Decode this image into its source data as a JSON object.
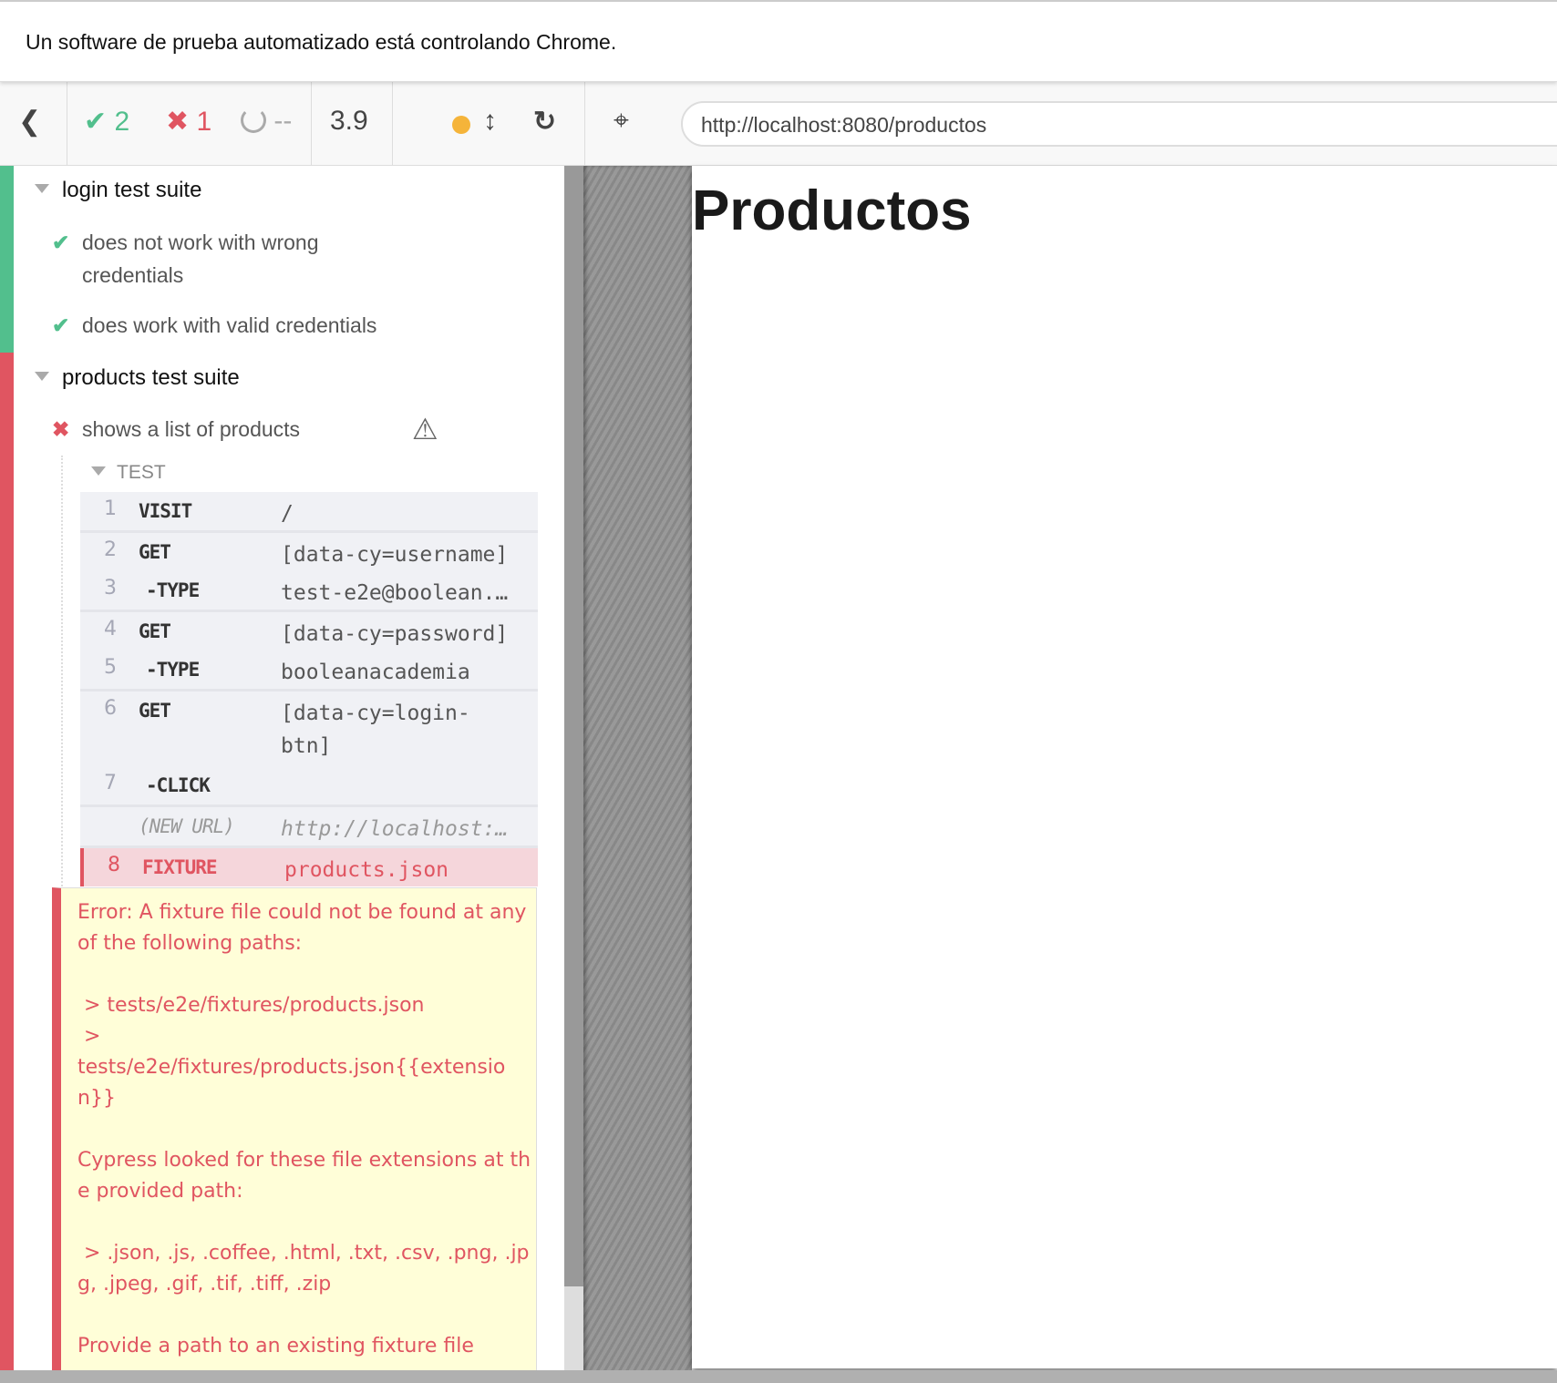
{
  "banner": "Un software de prueba automatizado está controlando Chrome.",
  "toolbar": {
    "passed": "2",
    "failed": "1",
    "pending": "--",
    "duration": "3.9",
    "url": "http://localhost:8080/productos"
  },
  "suites": [
    {
      "title": "login test suite",
      "tests": [
        {
          "title": "does not work with wrong credentials",
          "state": "passed"
        },
        {
          "title": "does work with valid credentials",
          "state": "passed"
        }
      ]
    },
    {
      "title": "products test suite",
      "tests": [
        {
          "title": "shows a list of products",
          "state": "failed"
        }
      ]
    }
  ],
  "test_header": "TEST",
  "commands": [
    {
      "n": "1",
      "cmd": "VISIT",
      "msg": "/"
    },
    {
      "n": "2",
      "cmd": "GET",
      "msg": "[data-cy=username]"
    },
    {
      "n": "3",
      "cmd": "-TYPE",
      "msg": "test-e2e@boolean.…"
    },
    {
      "n": "4",
      "cmd": "GET",
      "msg": "[data-cy=password]"
    },
    {
      "n": "5",
      "cmd": "-TYPE",
      "msg": "booleanacademia"
    },
    {
      "n": "6",
      "cmd": "GET",
      "msg": "[data-cy=login-btn]"
    },
    {
      "n": "7",
      "cmd": "-CLICK",
      "msg": ""
    },
    {
      "n": "",
      "cmd": "(NEW URL)",
      "msg": "http://localhost:…"
    },
    {
      "n": "8",
      "cmd": "FIXTURE",
      "msg": "products.json"
    }
  ],
  "error": "Error: A fixture file could not be found at any of the following paths:\n\n > tests/e2e/fixtures/products.json\n >\ntests/e2e/fixtures/products.json{{extension}}\n\nCypress looked for these file extensions at the provided path:\n\n > .json, .js, .coffee, .html, .txt, .csv, .png, .jpg, .jpeg, .gif, .tif, .tiff, .zip\n\nProvide a path to an existing fixture file",
  "aut": {
    "heading": "Productos"
  },
  "colors": {
    "pass": "#52bf8d",
    "fail": "#e05561",
    "warn": "#f5b43a"
  }
}
